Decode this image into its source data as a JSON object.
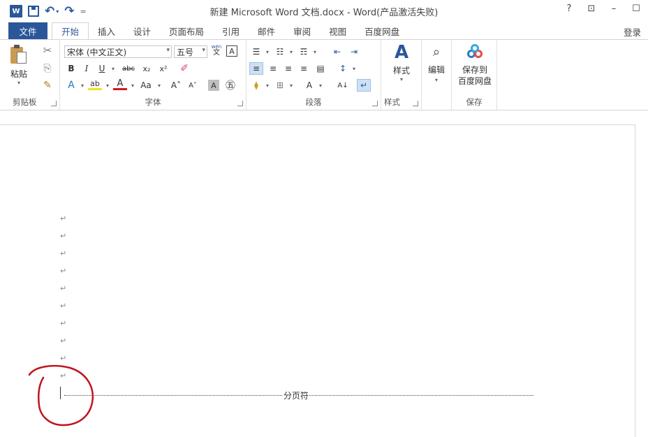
{
  "window": {
    "title": "新建 Microsoft Word 文档.docx - Word(产品激活失败)",
    "controls": [
      "?",
      "⊡",
      "–",
      "☐"
    ]
  },
  "quick_access": {
    "logo": "W",
    "undo": "↶",
    "redo": "↷",
    "customize": "=",
    "drop": "▾"
  },
  "tabs": [
    {
      "label": "文件"
    },
    {
      "label": "开始"
    },
    {
      "label": "插入"
    },
    {
      "label": "设计"
    },
    {
      "label": "页面布局"
    },
    {
      "label": "引用"
    },
    {
      "label": "邮件"
    },
    {
      "label": "审阅"
    },
    {
      "label": "视图"
    },
    {
      "label": "百度网盘"
    }
  ],
  "signin": "登录",
  "ribbon": {
    "clipboard": {
      "label": "剪贴板",
      "paste_label": "粘贴",
      "paste_drop": "▾",
      "cut": "✂",
      "copy": "⎘",
      "format_painter": "✎"
    },
    "font": {
      "label": "字体",
      "font_name": "宋体 (中文正文)",
      "font_size": "五号",
      "phonetic_top": "wén",
      "phonetic_bottom": "文",
      "char_border": "A",
      "bold": "B",
      "italic": "I",
      "underline": "U",
      "strike": "abc",
      "subscript": "x₂",
      "superscript": "x²",
      "eraser": "✐",
      "text_effects": "A",
      "highlight": "ab",
      "font_color": "A",
      "change_case": "Aa",
      "grow": "A˄",
      "shrink": "A˅",
      "shading": "A",
      "enclose": "㊄",
      "dropdown": "▾"
    },
    "paragraph": {
      "label": "段落",
      "bullets": "☰",
      "numbering": "☷",
      "multilevel": "☶",
      "outdent": "⇤",
      "indent": "⇥",
      "align_left": "≡",
      "align_center": "≡",
      "align_right": "≡",
      "justify": "≡",
      "distributed": "▤",
      "line_spacing": "↕",
      "shading": "⧫",
      "borders": "⊞",
      "asian_layout": "A",
      "sort": "A↓",
      "show_marks": "↵",
      "dropdown": "▾"
    },
    "styles": {
      "label": "样式",
      "button": "样式",
      "icon": "A",
      "drop": "▾"
    },
    "editing": {
      "button": "编辑",
      "icon": "⌕",
      "drop": "▾"
    },
    "save": {
      "label": "保存",
      "line1": "保存到",
      "line2": "百度网盘"
    }
  },
  "document": {
    "paragraph_mark": "↵",
    "page_break_label": "分页符"
  },
  "colors": {
    "accent": "#2b579a",
    "annotation": "#c0141c"
  }
}
